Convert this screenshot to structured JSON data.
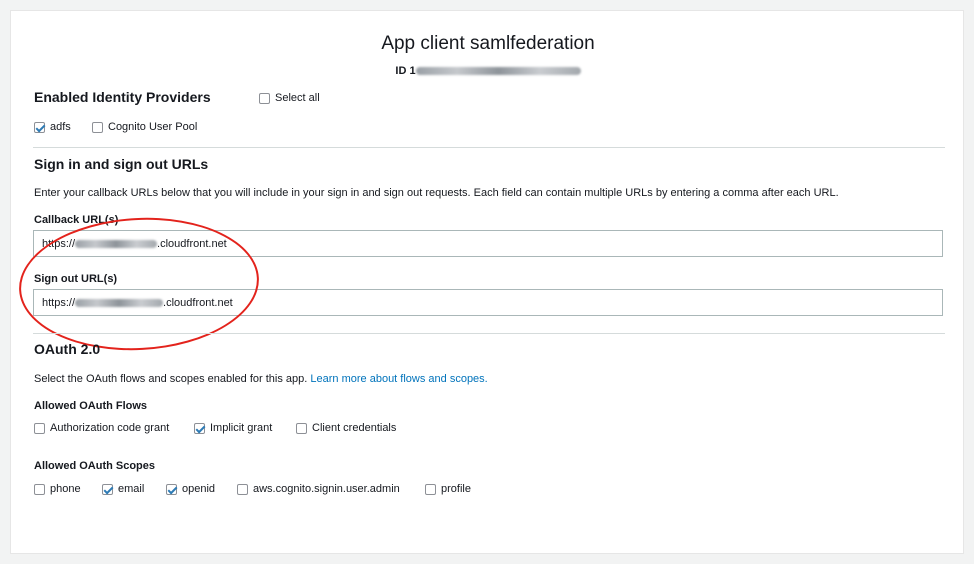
{
  "header": {
    "title_prefix": "App client",
    "title_name": "samlfederation",
    "id_label": "ID",
    "id_value_prefix": "1"
  },
  "identity_providers": {
    "heading": "Enabled Identity Providers",
    "select_all_label": "Select all",
    "select_all_checked": false,
    "providers": [
      {
        "label": "adfs",
        "checked": true
      },
      {
        "label": "Cognito User Pool",
        "checked": false
      }
    ]
  },
  "urls": {
    "heading": "Sign in and sign out URLs",
    "description": "Enter your callback URLs below that you will include in your sign in and sign out requests. Each field can contain multiple URLs by entering a comma after each URL.",
    "callback_label": "Callback URL(s)",
    "callback_prefix": "https://",
    "callback_suffix": ".cloudfront.net",
    "signout_label": "Sign out URL(s)",
    "signout_prefix": "https://",
    "signout_suffix": ".cloudfront.net",
    "annotation_color": "#e3231c"
  },
  "oauth": {
    "heading": "OAuth 2.0",
    "description": "Select the OAuth flows and scopes enabled for this app.",
    "learn_more_link": "Learn more about flows and scopes.",
    "flows_heading": "Allowed OAuth Flows",
    "flows": [
      {
        "label": "Authorization code grant",
        "checked": false
      },
      {
        "label": "Implicit grant",
        "checked": true
      },
      {
        "label": "Client credentials",
        "checked": false
      }
    ],
    "scopes_heading": "Allowed OAuth Scopes",
    "scopes": [
      {
        "label": "phone",
        "checked": false
      },
      {
        "label": "email",
        "checked": true
      },
      {
        "label": "openid",
        "checked": true
      },
      {
        "label": "aws.cognito.signin.user.admin",
        "checked": false
      },
      {
        "label": "profile",
        "checked": false
      }
    ]
  }
}
